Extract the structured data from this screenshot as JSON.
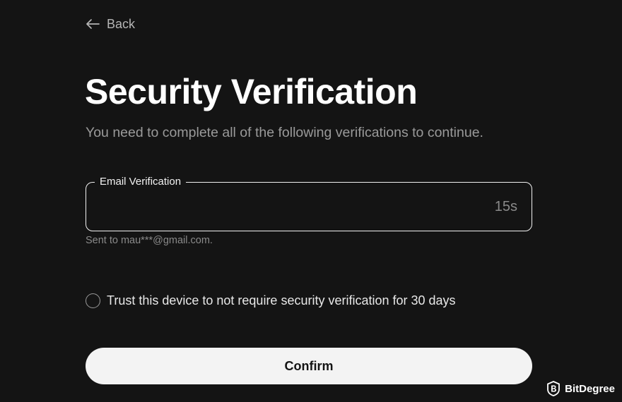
{
  "nav": {
    "back_label": "Back",
    "back_icon": "arrow-left-icon"
  },
  "header": {
    "title": "Security Verification",
    "subtitle": "You need to complete all of the following verifications to continue."
  },
  "email_verification": {
    "label": "Email Verification",
    "value": "",
    "countdown": "15s",
    "helper": "Sent to mau***@gmail.com."
  },
  "trust_device": {
    "label": "Trust this device to not require security verification for 30 days",
    "checked": false
  },
  "actions": {
    "confirm_label": "Confirm"
  },
  "watermark": {
    "brand": "BitDegree",
    "logo_icon": "bitdegree-logo-icon"
  },
  "colors": {
    "background": "#141414",
    "text_primary": "#ffffff",
    "text_muted": "#9a9a9a",
    "button_bg": "#f3f3f3",
    "button_text": "#141414"
  }
}
